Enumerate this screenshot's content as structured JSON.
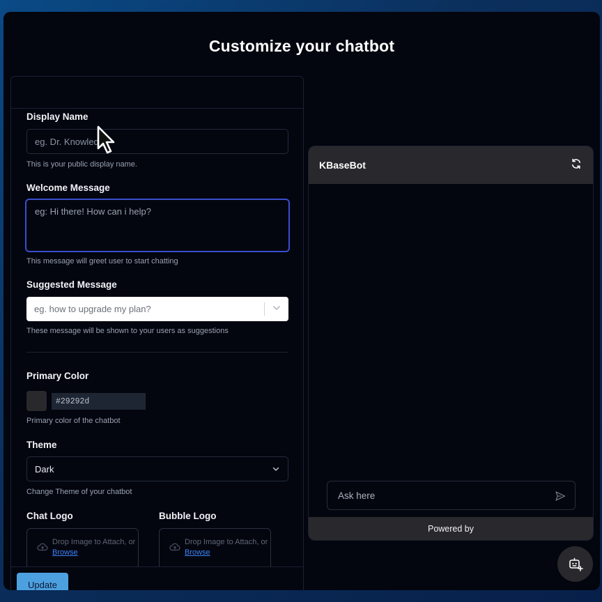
{
  "page": {
    "title": "Customize your chatbot"
  },
  "form": {
    "display_name": {
      "label": "Display Name",
      "placeholder": "eg. Dr. Knowledge",
      "hint": "This is your public display name."
    },
    "welcome_message": {
      "label": "Welcome Message",
      "placeholder": "eg: Hi there! How can i help?",
      "hint": "This message will greet user to start chatting"
    },
    "suggested_message": {
      "label": "Suggested Message",
      "placeholder": "eg. how to upgrade my plan?",
      "hint": "These message will be shown to your users as suggestions"
    },
    "primary_color": {
      "label": "Primary Color",
      "value": "#29292d",
      "hint": "Primary color of the chatbot"
    },
    "theme": {
      "label": "Theme",
      "value": "Dark",
      "hint": "Change Theme of your chatbot"
    },
    "chat_logo": {
      "label": "Chat Logo",
      "drop_text": "Drop Image to Attach, or",
      "browse": "Browse"
    },
    "bubble_logo": {
      "label": "Bubble Logo",
      "drop_text": "Drop Image to Attach, or",
      "browse": "Browse"
    },
    "update_label": "Update"
  },
  "preview": {
    "bot_name": "KBaseBot",
    "input_placeholder": "Ask here",
    "powered_by": "Powered by"
  },
  "icons": {
    "refresh": "refresh-icon",
    "send": "send-icon",
    "chevron": "chevron-down-icon",
    "cloud": "cloud-upload-icon",
    "bubble": "chatbot-icon",
    "cursor": "mouse-pointer-icon"
  },
  "colors": {
    "accent_focus": "#3a4ecf",
    "update_button": "#4da0e0",
    "primary": "#29292d",
    "link": "#3b82f6"
  }
}
